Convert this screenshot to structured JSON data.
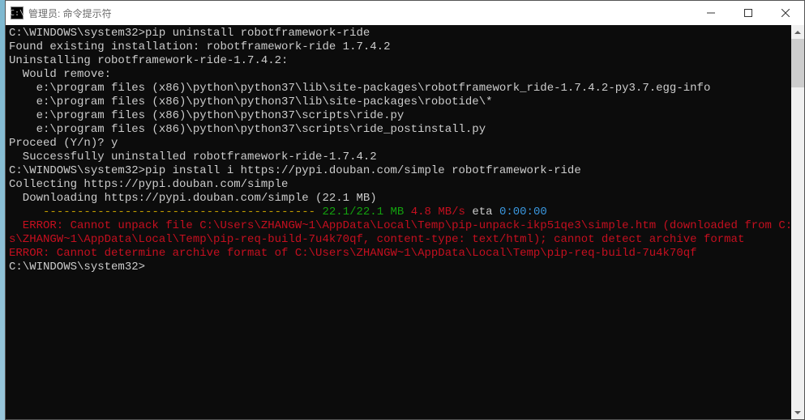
{
  "window": {
    "title": "管理员: 命令提示符"
  },
  "terminal": {
    "blank1": "",
    "l1_prompt": "C:\\WINDOWS\\system32>",
    "l1_cmd": "pip uninstall robotframework-ride",
    "l2": "Found existing installation: robotframework-ride 1.7.4.2",
    "l3": "Uninstalling robotframework-ride-1.7.4.2:",
    "l4": "  Would remove:",
    "l5": "    e:\\program files (x86)\\python\\python37\\lib\\site-packages\\robotframework_ride-1.7.4.2-py3.7.egg-info",
    "l6": "    e:\\program files (x86)\\python\\python37\\lib\\site-packages\\robotide\\*",
    "l7": "    e:\\program files (x86)\\python\\python37\\scripts\\ride.py",
    "l8": "    e:\\program files (x86)\\python\\python37\\scripts\\ride_postinstall.py",
    "l9_q": "Proceed (Y/n)? ",
    "l9_a": "y",
    "l10": "  Successfully uninstalled robotframework-ride-1.7.4.2",
    "blank2": "",
    "l11_prompt": "C:\\WINDOWS\\system32>",
    "l11_cmd": "pip install i https://pypi.douban.com/simple robotframework-ride",
    "l12": "Collecting https://pypi.douban.com/simple",
    "l13": "  Downloading https://pypi.douban.com/simple (22.1 MB)",
    "l14_ind": "     ",
    "l14_bar": "---------------------------------------- ",
    "l14_done": "22.1/22.1 MB",
    "l14_sp": " ",
    "l14_speed": "4.8 MB/s",
    "l14_sp2": " eta ",
    "l14_eta": "0:00:00",
    "l15a": "  ERROR: Cannot unpack file C:\\Users\\ZHANGW~1\\AppData\\Local\\Temp\\pip-unpack-ikp51qe3\\simple.htm (downloaded from C:\\User",
    "l15b": "s\\ZHANGW~1\\AppData\\Local\\Temp\\pip-req-build-7u4k70qf, content-type: text/html); cannot detect archive format",
    "l16": "ERROR: Cannot determine archive format of C:\\Users\\ZHANGW~1\\AppData\\Local\\Temp\\pip-req-build-7u4k70qf",
    "blank3": "",
    "l17_prompt": "C:\\WINDOWS\\system32>",
    "l17_cursor": ""
  }
}
